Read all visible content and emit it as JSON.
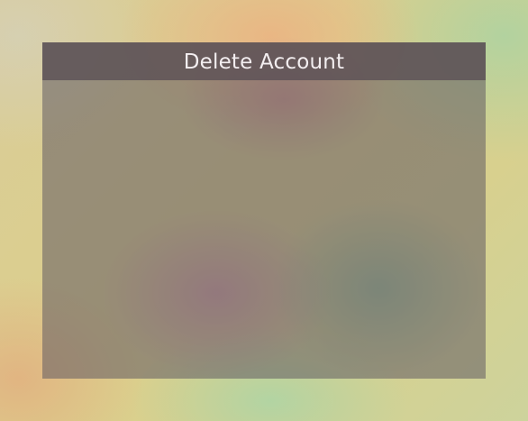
{
  "dialog": {
    "title": "Delete Account"
  }
}
